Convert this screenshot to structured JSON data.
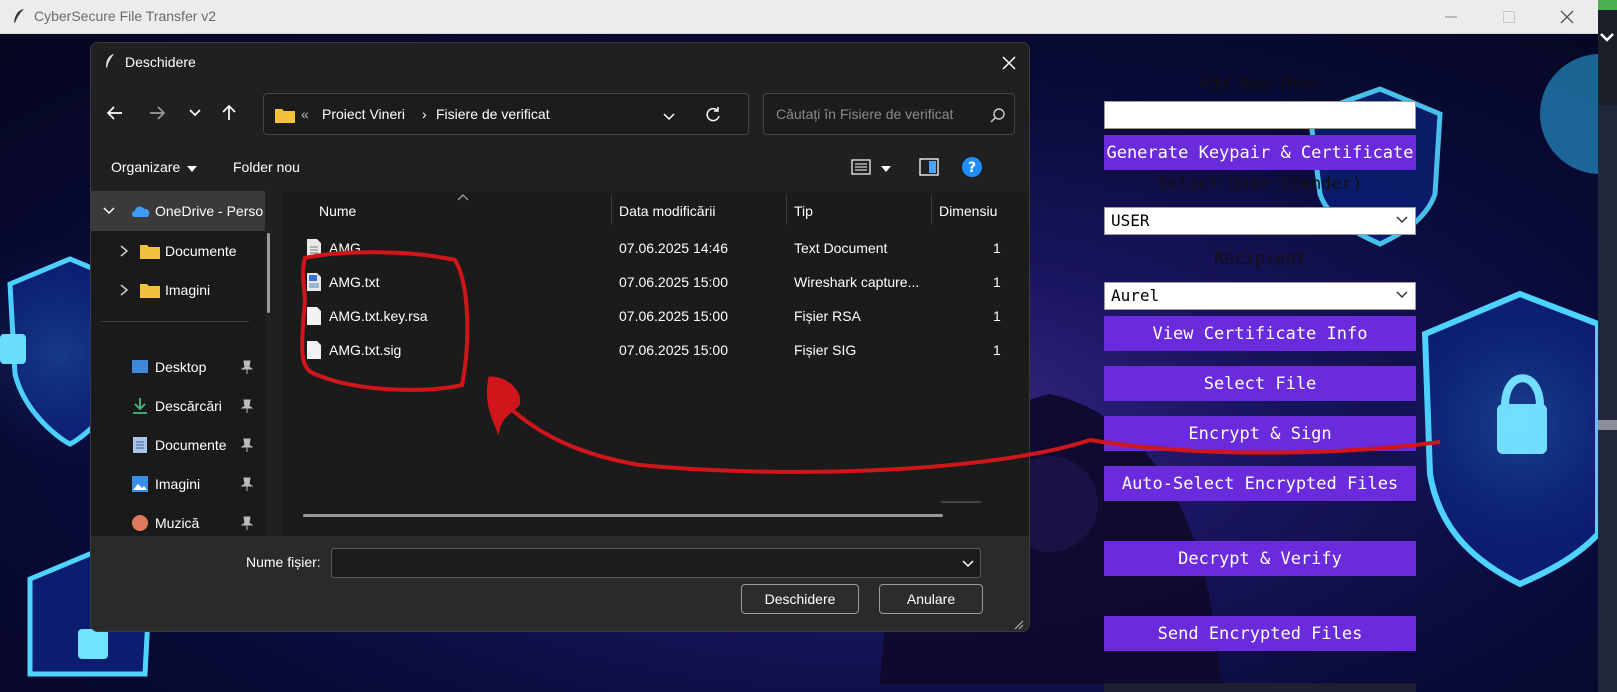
{
  "window": {
    "title": "CyberSecure File Transfer v2"
  },
  "panel": {
    "add_user_label": "Add New User",
    "new_user_value": "",
    "generate_button": "Generate Keypair & Certificate",
    "select_user_label": "Select User (Sender)",
    "sender_value": "USER",
    "recipient_label": "Recipient",
    "recipient_value": "Aurel",
    "view_cert_button": "View Certificate Info",
    "select_file_button": "Select File",
    "encrypt_button": "Encrypt & Sign",
    "auto_select_button": "Auto-Select Encrypted Files",
    "decrypt_button": "Decrypt & Verify",
    "send_button": "Send Encrypted Files"
  },
  "dialog": {
    "title": "Deschidere",
    "breadcrumb": [
      "Proiect Vineri",
      "Fisiere de verificat"
    ],
    "search_placeholder": "Căutați în Fisiere de verificat",
    "toolbar": {
      "organize": "Organizare",
      "new_folder": "Folder nou"
    },
    "nav_items": [
      {
        "label": "OneDrive - Perso",
        "icon": "cloud-icon"
      },
      {
        "label": "Documente",
        "icon": "folder-icon"
      },
      {
        "label": "Imagini",
        "icon": "folder-icon"
      },
      {
        "label": "Desktop",
        "icon": "desktop-icon"
      },
      {
        "label": "Descărcări",
        "icon": "download-icon"
      },
      {
        "label": "Documente",
        "icon": "document-icon"
      },
      {
        "label": "Imagini",
        "icon": "pictures-icon"
      },
      {
        "label": "Muzică",
        "icon": "music-icon"
      }
    ],
    "columns": [
      "Nume",
      "Data modificării",
      "Tip",
      "Dimensiu"
    ],
    "files": [
      {
        "name": "AMG",
        "date": "07.06.2025 14:46",
        "type": "Text Document",
        "size": "1"
      },
      {
        "name": "AMG.txt",
        "date": "07.06.2025 15:00",
        "type": "Wireshark capture...",
        "size": "1"
      },
      {
        "name": "AMG.txt.key.rsa",
        "date": "07.06.2025 15:00",
        "type": "Fișier RSA",
        "size": "1"
      },
      {
        "name": "AMG.txt.sig",
        "date": "07.06.2025 15:00",
        "type": "Fișier SIG",
        "size": "1"
      }
    ],
    "filename_label": "Nume fișier:",
    "filename_value": "",
    "open_button": "Deschidere",
    "cancel_button": "Anulare"
  },
  "colors": {
    "accent_button": "#6a2bdc",
    "annotation": "#d0151b",
    "dialog_bg": "#202020"
  }
}
